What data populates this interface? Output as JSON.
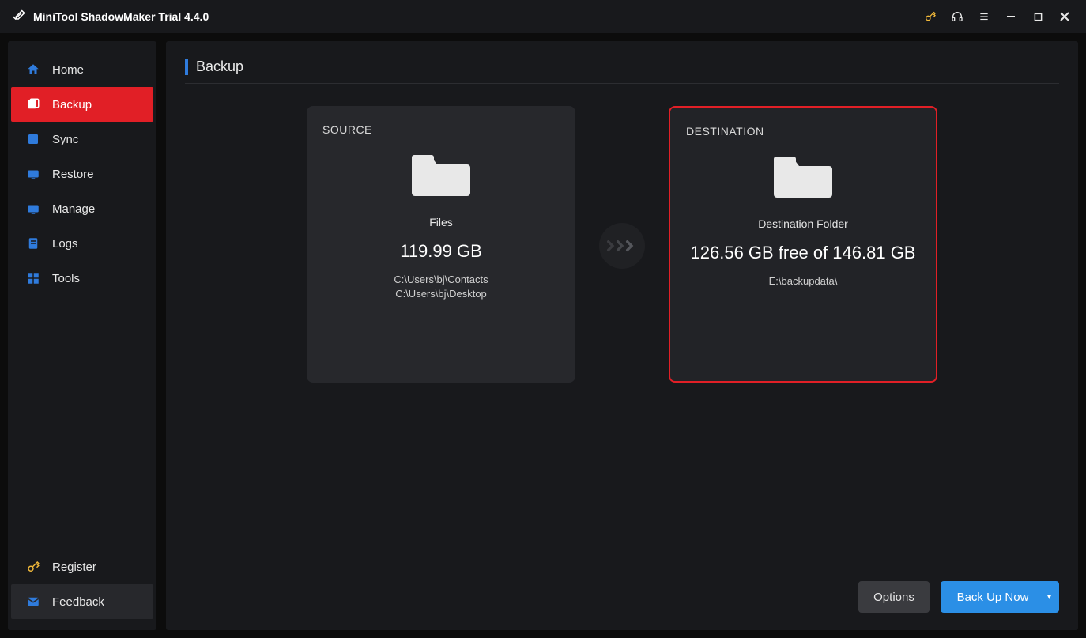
{
  "window": {
    "title": "MiniTool ShadowMaker Trial 4.4.0"
  },
  "sidebar": {
    "items": [
      {
        "label": "Home"
      },
      {
        "label": "Backup"
      },
      {
        "label": "Sync"
      },
      {
        "label": "Restore"
      },
      {
        "label": "Manage"
      },
      {
        "label": "Logs"
      },
      {
        "label": "Tools"
      }
    ],
    "register_label": "Register",
    "feedback_label": "Feedback"
  },
  "page": {
    "title": "Backup"
  },
  "source": {
    "label": "SOURCE",
    "type": "Files",
    "size": "119.99 GB",
    "path1": "C:\\Users\\bj\\Contacts",
    "path2": "C:\\Users\\bj\\Desktop"
  },
  "destination": {
    "label": "DESTINATION",
    "type": "Destination Folder",
    "size": "126.56 GB free of 146.81 GB",
    "path": "E:\\backupdata\\"
  },
  "footer": {
    "options_label": "Options",
    "backup_label": "Back Up Now"
  }
}
